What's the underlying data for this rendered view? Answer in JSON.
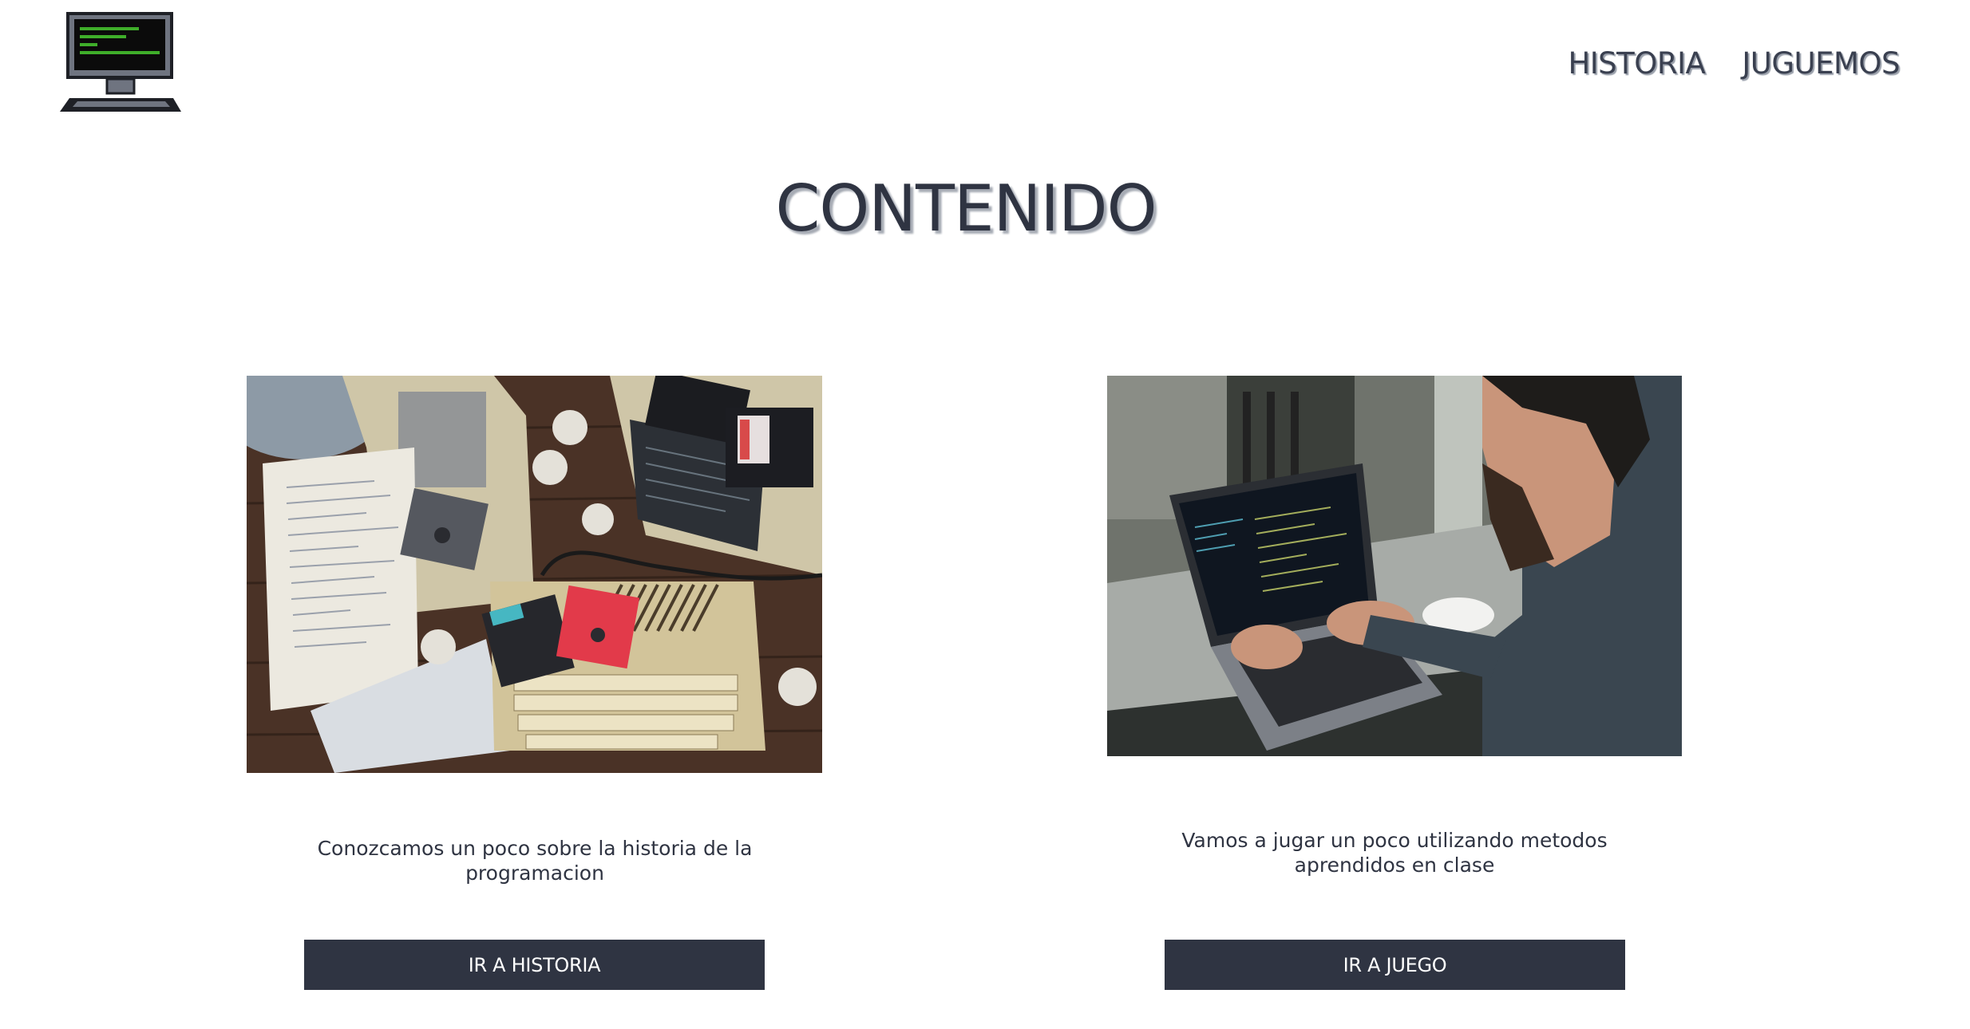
{
  "header": {
    "logo_icon": "retro-computer-monitor-icon",
    "nav": [
      {
        "label": "HISTORIA"
      },
      {
        "label": "JUGUEMOS"
      }
    ]
  },
  "main": {
    "title": "CONTENIDO",
    "cards": [
      {
        "image": "retro-computers-floppy-disks-photo",
        "description": "Conozcamos un poco sobre la historia de la programacion",
        "button_label": "IR A HISTORIA"
      },
      {
        "image": "man-coding-on-laptop-photo",
        "description": "Vamos a jugar un poco utilizando metodos aprendidos en clase",
        "button_label": "IR A JUEGO"
      }
    ]
  },
  "colors": {
    "primary_dark": "#2f3442",
    "background": "#ffffff",
    "screen_green": "#3fae2a"
  }
}
